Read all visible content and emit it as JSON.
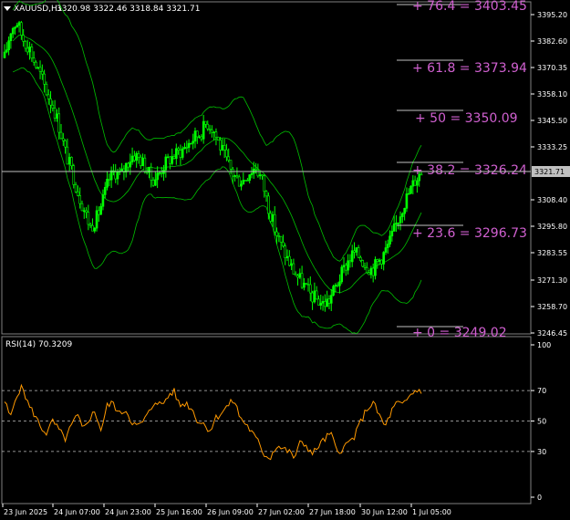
{
  "header": {
    "symbol": "XAUUSD,H1",
    "ohlc": "3320.98 3322.46 3318.84 3321.71",
    "caret_icon": "triangle-down-icon"
  },
  "price_axis": {
    "labels": [
      "3395.20",
      "3382.60",
      "3370.35",
      "3358.10",
      "3345.50",
      "3333.25",
      "3308.40",
      "3295.80",
      "3283.55",
      "3271.30",
      "3258.70",
      "3246.45"
    ],
    "current_price": "3321.71"
  },
  "fib_levels": [
    {
      "label": "+ 76.4  = 3403.45"
    },
    {
      "label": "+ 61.8  = 3373.94"
    },
    {
      "label": "+ 50  = 3350.09"
    },
    {
      "label": "+ 38.2  = 3326.24"
    },
    {
      "label": "+ 23.6  = 3296.73"
    },
    {
      "label": "+ 0  = 3249.02"
    }
  ],
  "rsi": {
    "title": "RSI(14) 70.3209",
    "axis_labels": [
      "100",
      "70",
      "50",
      "30",
      "0"
    ],
    "levels": [
      70,
      50,
      30
    ]
  },
  "time_axis": {
    "labels": [
      "23 Jun 2025",
      "24 Jun 07:00",
      "24 Jun 23:00",
      "25 Jun 16:00",
      "26 Jun 09:00",
      "27 Jun 02:00",
      "27 Jun 18:00",
      "30 Jun 12:00",
      "1 Jul 05:00"
    ]
  },
  "colors": {
    "background": "#000000",
    "candle_bull": "#00ff00",
    "candle_bear": "#00ff00",
    "bollinger": "#00c000",
    "fib_text": "#d060d0",
    "rsi_line": "#ff9900",
    "price_line": "#c0c0c0"
  },
  "chart_data": {
    "type": "candlestick",
    "symbol": "XAUUSD",
    "timeframe": "H1",
    "ylim": [
      3246.45,
      3398
    ],
    "close_path": [
      3375,
      3388,
      3392,
      3384,
      3380,
      3372,
      3366,
      3358,
      3352,
      3342,
      3330,
      3322,
      3312,
      3304,
      3296,
      3300,
      3308,
      3318,
      3322,
      3320,
      3326,
      3330,
      3328,
      3324,
      3318,
      3320,
      3325,
      3328,
      3330,
      3332,
      3335,
      3338,
      3340,
      3345,
      3342,
      3335,
      3328,
      3322,
      3318,
      3318,
      3322,
      3324,
      3318,
      3306,
      3296,
      3288,
      3282,
      3276,
      3272,
      3268,
      3264,
      3262,
      3260,
      3262,
      3268,
      3274,
      3280,
      3284,
      3282,
      3278,
      3276,
      3280,
      3284,
      3290,
      3298,
      3306,
      3312,
      3318,
      3322
    ],
    "rsi_path": [
      63,
      52,
      68,
      72,
      60,
      54,
      46,
      42,
      50,
      44,
      38,
      46,
      54,
      44,
      52,
      56,
      44,
      60,
      62,
      54,
      58,
      50,
      46,
      50,
      56,
      64,
      60,
      66,
      70,
      60,
      62,
      58,
      50,
      48,
      44,
      52,
      56,
      60,
      64,
      52,
      48,
      42,
      36,
      28,
      26,
      34,
      32,
      30,
      26,
      36,
      34,
      28,
      34,
      38,
      42,
      30,
      32,
      36,
      40,
      50,
      58,
      62,
      54,
      46,
      56,
      62,
      60,
      66,
      70,
      70
    ]
  }
}
